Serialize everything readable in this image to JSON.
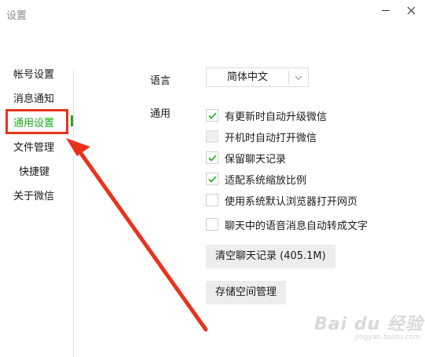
{
  "window": {
    "title": "设置"
  },
  "sidebar": {
    "items": [
      {
        "label": "帐号设置"
      },
      {
        "label": "消息通知"
      },
      {
        "label": "通用设置"
      },
      {
        "label": "文件管理"
      },
      {
        "label": "快捷键"
      },
      {
        "label": "关于微信"
      }
    ],
    "active_index": 2
  },
  "main": {
    "language": {
      "label": "语言",
      "value": "简体中文"
    },
    "general": {
      "label": "通用",
      "options": [
        {
          "label": "有更新时自动升级微信",
          "checked": true,
          "enabled": true
        },
        {
          "label": "开机时自动打开微信",
          "checked": false,
          "enabled": false
        },
        {
          "label": "保留聊天记录",
          "checked": true,
          "enabled": true
        },
        {
          "label": "适配系统缩放比例",
          "checked": true,
          "enabled": true
        },
        {
          "label": "使用系统默认浏览器打开网页",
          "checked": false,
          "enabled": true
        },
        {
          "label": "聊天中的语音消息自动转成文字",
          "checked": false,
          "enabled": true
        }
      ]
    },
    "buttons": {
      "clear_history": "清空聊天记录 (405.1M)",
      "storage_manage": "存储空间管理"
    }
  },
  "annotation": {
    "color": "#e8321d"
  },
  "theme": {
    "accent": "#1aad19"
  },
  "watermark": {
    "text": "Bai du 经验",
    "sub": "jingyan.baidu.com"
  }
}
